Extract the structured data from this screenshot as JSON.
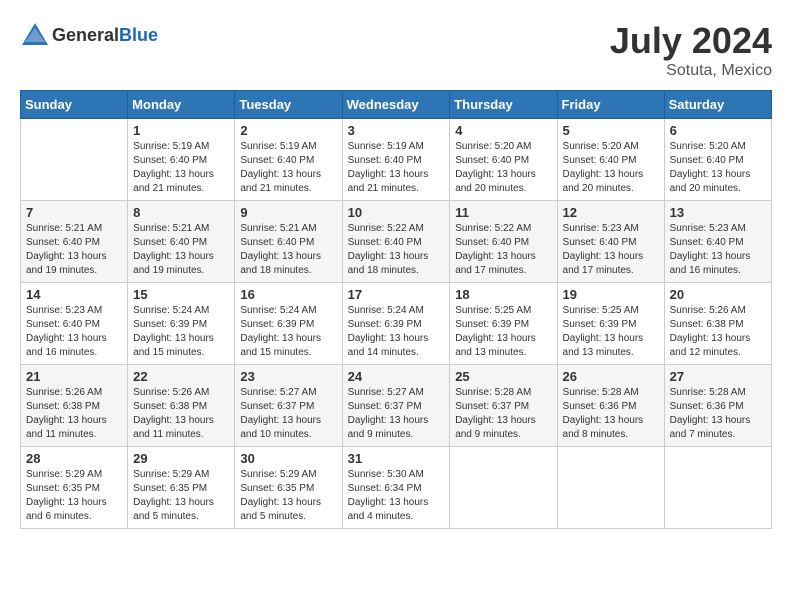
{
  "header": {
    "logo_general": "General",
    "logo_blue": "Blue",
    "month_year": "July 2024",
    "location": "Sotuta, Mexico"
  },
  "weekdays": [
    "Sunday",
    "Monday",
    "Tuesday",
    "Wednesday",
    "Thursday",
    "Friday",
    "Saturday"
  ],
  "weeks": [
    [
      {
        "day": "",
        "info": ""
      },
      {
        "day": "1",
        "info": "Sunrise: 5:19 AM\nSunset: 6:40 PM\nDaylight: 13 hours\nand 21 minutes."
      },
      {
        "day": "2",
        "info": "Sunrise: 5:19 AM\nSunset: 6:40 PM\nDaylight: 13 hours\nand 21 minutes."
      },
      {
        "day": "3",
        "info": "Sunrise: 5:19 AM\nSunset: 6:40 PM\nDaylight: 13 hours\nand 21 minutes."
      },
      {
        "day": "4",
        "info": "Sunrise: 5:20 AM\nSunset: 6:40 PM\nDaylight: 13 hours\nand 20 minutes."
      },
      {
        "day": "5",
        "info": "Sunrise: 5:20 AM\nSunset: 6:40 PM\nDaylight: 13 hours\nand 20 minutes."
      },
      {
        "day": "6",
        "info": "Sunrise: 5:20 AM\nSunset: 6:40 PM\nDaylight: 13 hours\nand 20 minutes."
      }
    ],
    [
      {
        "day": "7",
        "info": "Sunrise: 5:21 AM\nSunset: 6:40 PM\nDaylight: 13 hours\nand 19 minutes."
      },
      {
        "day": "8",
        "info": "Sunrise: 5:21 AM\nSunset: 6:40 PM\nDaylight: 13 hours\nand 19 minutes."
      },
      {
        "day": "9",
        "info": "Sunrise: 5:21 AM\nSunset: 6:40 PM\nDaylight: 13 hours\nand 18 minutes."
      },
      {
        "day": "10",
        "info": "Sunrise: 5:22 AM\nSunset: 6:40 PM\nDaylight: 13 hours\nand 18 minutes."
      },
      {
        "day": "11",
        "info": "Sunrise: 5:22 AM\nSunset: 6:40 PM\nDaylight: 13 hours\nand 17 minutes."
      },
      {
        "day": "12",
        "info": "Sunrise: 5:23 AM\nSunset: 6:40 PM\nDaylight: 13 hours\nand 17 minutes."
      },
      {
        "day": "13",
        "info": "Sunrise: 5:23 AM\nSunset: 6:40 PM\nDaylight: 13 hours\nand 16 minutes."
      }
    ],
    [
      {
        "day": "14",
        "info": "Sunrise: 5:23 AM\nSunset: 6:40 PM\nDaylight: 13 hours\nand 16 minutes."
      },
      {
        "day": "15",
        "info": "Sunrise: 5:24 AM\nSunset: 6:39 PM\nDaylight: 13 hours\nand 15 minutes."
      },
      {
        "day": "16",
        "info": "Sunrise: 5:24 AM\nSunset: 6:39 PM\nDaylight: 13 hours\nand 15 minutes."
      },
      {
        "day": "17",
        "info": "Sunrise: 5:24 AM\nSunset: 6:39 PM\nDaylight: 13 hours\nand 14 minutes."
      },
      {
        "day": "18",
        "info": "Sunrise: 5:25 AM\nSunset: 6:39 PM\nDaylight: 13 hours\nand 13 minutes."
      },
      {
        "day": "19",
        "info": "Sunrise: 5:25 AM\nSunset: 6:39 PM\nDaylight: 13 hours\nand 13 minutes."
      },
      {
        "day": "20",
        "info": "Sunrise: 5:26 AM\nSunset: 6:38 PM\nDaylight: 13 hours\nand 12 minutes."
      }
    ],
    [
      {
        "day": "21",
        "info": "Sunrise: 5:26 AM\nSunset: 6:38 PM\nDaylight: 13 hours\nand 11 minutes."
      },
      {
        "day": "22",
        "info": "Sunrise: 5:26 AM\nSunset: 6:38 PM\nDaylight: 13 hours\nand 11 minutes."
      },
      {
        "day": "23",
        "info": "Sunrise: 5:27 AM\nSunset: 6:37 PM\nDaylight: 13 hours\nand 10 minutes."
      },
      {
        "day": "24",
        "info": "Sunrise: 5:27 AM\nSunset: 6:37 PM\nDaylight: 13 hours\nand 9 minutes."
      },
      {
        "day": "25",
        "info": "Sunrise: 5:28 AM\nSunset: 6:37 PM\nDaylight: 13 hours\nand 9 minutes."
      },
      {
        "day": "26",
        "info": "Sunrise: 5:28 AM\nSunset: 6:36 PM\nDaylight: 13 hours\nand 8 minutes."
      },
      {
        "day": "27",
        "info": "Sunrise: 5:28 AM\nSunset: 6:36 PM\nDaylight: 13 hours\nand 7 minutes."
      }
    ],
    [
      {
        "day": "28",
        "info": "Sunrise: 5:29 AM\nSunset: 6:35 PM\nDaylight: 13 hours\nand 6 minutes."
      },
      {
        "day": "29",
        "info": "Sunrise: 5:29 AM\nSunset: 6:35 PM\nDaylight: 13 hours\nand 5 minutes."
      },
      {
        "day": "30",
        "info": "Sunrise: 5:29 AM\nSunset: 6:35 PM\nDaylight: 13 hours\nand 5 minutes."
      },
      {
        "day": "31",
        "info": "Sunrise: 5:30 AM\nSunset: 6:34 PM\nDaylight: 13 hours\nand 4 minutes."
      },
      {
        "day": "",
        "info": ""
      },
      {
        "day": "",
        "info": ""
      },
      {
        "day": "",
        "info": ""
      }
    ]
  ]
}
